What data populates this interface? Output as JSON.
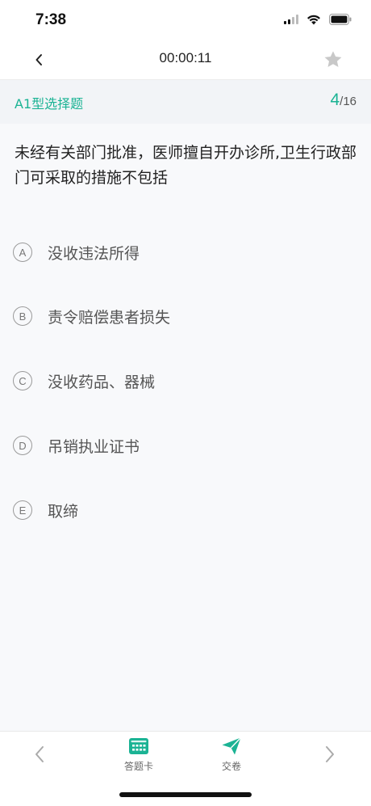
{
  "status_bar": {
    "time": "7:38"
  },
  "nav": {
    "timer": "00:00:11"
  },
  "section": {
    "type_label": "A1型选择题",
    "current": "4",
    "separator": "/",
    "total": "16"
  },
  "question": {
    "text": "未经有关部门批准，医师擅自开办诊所,卫生行政部门可采取的措施不包括"
  },
  "options": [
    {
      "letter": "A",
      "text": "没收违法所得"
    },
    {
      "letter": "B",
      "text": "责令赔偿患者损失"
    },
    {
      "letter": "C",
      "text": "没收药品、器械"
    },
    {
      "letter": "D",
      "text": "吊销执业证书"
    },
    {
      "letter": "E",
      "text": "取缔"
    }
  ],
  "tab_bar": {
    "answer_card_label": "答题卡",
    "submit_label": "交卷"
  },
  "colors": {
    "accent": "#1bb394",
    "star": "#c8c8c8"
  }
}
